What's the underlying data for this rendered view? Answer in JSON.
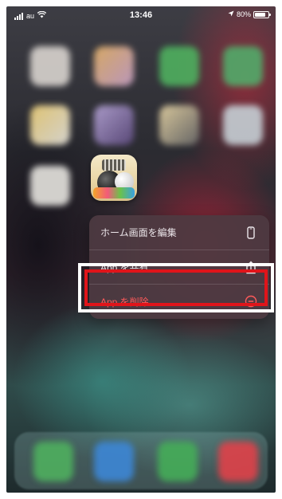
{
  "status_bar": {
    "carrier": "au",
    "time": "13:46",
    "battery": "80%",
    "battery_level": 0.8
  },
  "focused_app": {
    "icon": "app-icon"
  },
  "context_menu": {
    "items": [
      {
        "label": "ホーム画面を編集",
        "icon": "phone-icon"
      },
      {
        "label": "App を共有",
        "icon": "share-icon"
      },
      {
        "label": "App を削除",
        "icon": "minus-circle-icon",
        "color": "#ff5a5a"
      }
    ]
  },
  "highlight": {
    "outer_color": "#ffffff",
    "inner_color": "#e0141a"
  }
}
